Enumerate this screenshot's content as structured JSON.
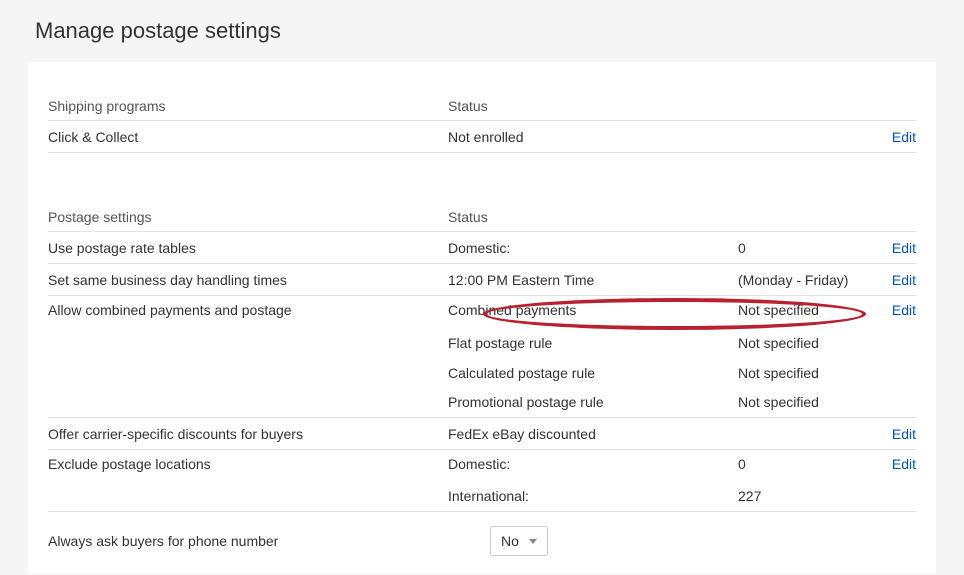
{
  "page": {
    "title": "Manage postage settings"
  },
  "common": {
    "edit": "Edit"
  },
  "shipping_programs": {
    "header_name": "Shipping programs",
    "header_status": "Status",
    "rows": [
      {
        "name": "Click & Collect",
        "status": "Not enrolled",
        "has_edit": true
      }
    ]
  },
  "postage_settings": {
    "header_name": "Postage settings",
    "header_status": "Status",
    "rate_tables": {
      "name": "Use postage rate tables",
      "status": "Domestic:",
      "extra": "0"
    },
    "handling_times": {
      "name": "Set same business day handling times",
      "status": "12:00 PM Eastern Time",
      "extra": "(Monday - Friday)"
    },
    "combined": {
      "name": "Allow combined payments and postage",
      "lines": [
        {
          "label": "Combined payments",
          "value": "Not specified"
        },
        {
          "label": "Flat postage rule",
          "value": "Not specified"
        },
        {
          "label": "Calculated postage rule",
          "value": "Not specified"
        },
        {
          "label": "Promotional postage rule",
          "value": "Not specified"
        }
      ]
    },
    "carrier_discounts": {
      "name": "Offer carrier-specific discounts for buyers",
      "status": "FedEx eBay discounted",
      "extra": ""
    },
    "exclude_locations": {
      "name": "Exclude postage locations",
      "lines": [
        {
          "label": "Domestic:",
          "value": "0"
        },
        {
          "label": "International:",
          "value": "227"
        }
      ]
    },
    "phone_number": {
      "name": "Always ask buyers for phone number",
      "value": "No"
    }
  }
}
